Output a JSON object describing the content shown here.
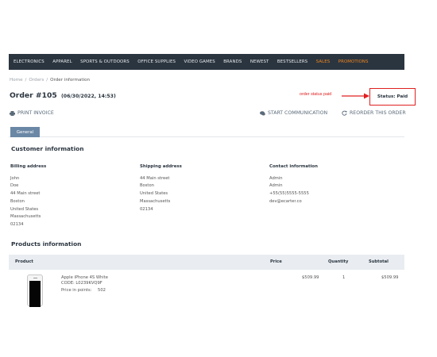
{
  "nav": {
    "items": [
      "ELECTRONICS",
      "APPAREL",
      "SPORTS & OUTDOORS",
      "OFFICE SUPPLIES",
      "VIDEO GAMES",
      "BRANDS",
      "NEWEST",
      "BESTSELLERS",
      "SALES",
      "PROMOTIONS"
    ]
  },
  "breadcrumb": {
    "home": "Home",
    "orders": "Orders",
    "current": "Order information",
    "separator": "/"
  },
  "order": {
    "title": "Order #105",
    "date": "(06/30/2022, 14:53)"
  },
  "annotation": {
    "text": "order status paid",
    "color": "#e02020"
  },
  "status": {
    "label": "Status: Paid"
  },
  "actions": {
    "print": "PRINT INVOICE",
    "start_communication": "START COMMUNICATION",
    "reorder": "REORDER THIS ORDER"
  },
  "tabs": {
    "general": "General"
  },
  "customer": {
    "title": "Customer information",
    "billing": {
      "heading": "Billing address",
      "lines": [
        "John",
        "Doe",
        "44 Main street",
        "Boston",
        "United States",
        "Massachusetts",
        "02134"
      ]
    },
    "shipping": {
      "heading": "Shipping address",
      "lines": [
        "44 Main street",
        "Boston",
        "United States",
        "Massachusetts",
        "02134"
      ]
    },
    "contact": {
      "heading": "Contact information",
      "lines": [
        "Admin",
        "Admin",
        "+55(55)5555-5555",
        "dev@ecarter.co"
      ]
    }
  },
  "products": {
    "title": "Products information",
    "columns": {
      "product": "Product",
      "price": "Price",
      "quantity": "Quantity",
      "subtotal": "Subtotal"
    },
    "rows": [
      {
        "name": "Apple iPhone 4S White",
        "code": "CODE: L0239KVQ9F",
        "points_label": "Price in points:",
        "points": "502",
        "price": "$509.99",
        "quantity": "1",
        "subtotal": "$509.99"
      }
    ]
  },
  "colors": {
    "nav_bg": "#2b3540",
    "accent_orange": "#f0861d",
    "tab_active": "#6a87a5",
    "annotation_red": "#e02020"
  }
}
